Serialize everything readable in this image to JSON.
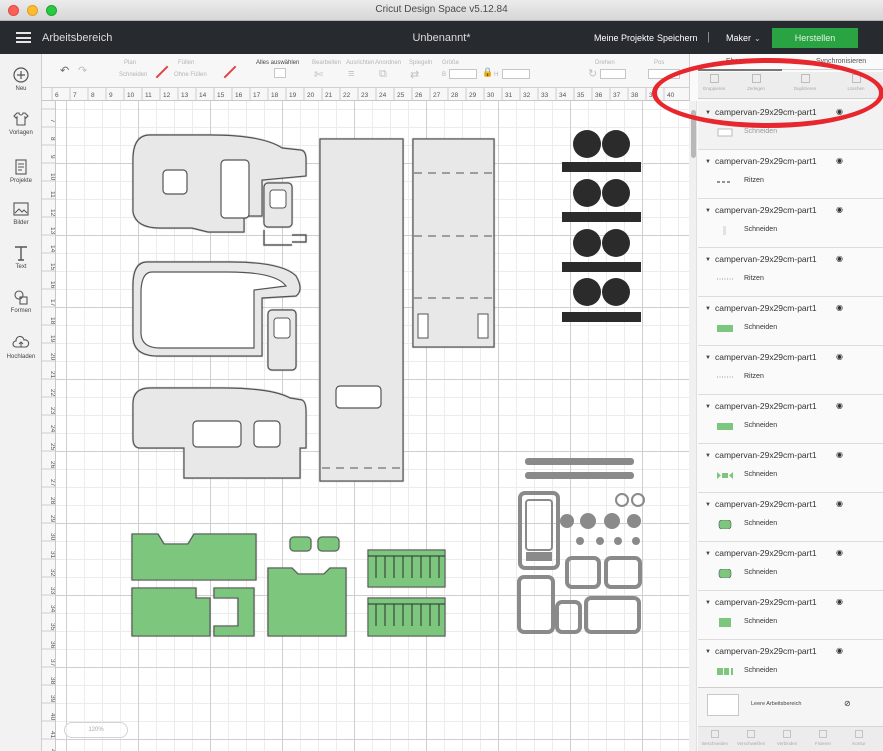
{
  "window": {
    "title": "Cricut Design Space  v5.12.84"
  },
  "header": {
    "workspace_label": "Arbeitsbereich",
    "project_name": "Unbenannt*",
    "my_projects": "Meine Projekte",
    "save": "Speichern",
    "separator": "|",
    "machine": "Maker",
    "make_it": "Herstellen"
  },
  "sidebar": {
    "items": [
      {
        "label": "Neu",
        "icon": "plus-circle-icon"
      },
      {
        "label": "Vorlagen",
        "icon": "shirt-icon"
      },
      {
        "label": "Projekte",
        "icon": "projects-icon"
      },
      {
        "label": "Bilder",
        "icon": "image-icon"
      },
      {
        "label": "Text",
        "icon": "text-icon"
      },
      {
        "label": "Formen",
        "icon": "shapes-icon"
      },
      {
        "label": "Hochladen",
        "icon": "upload-cloud-icon"
      }
    ]
  },
  "toolbar": {
    "line_type_label": "Plan",
    "line_type_value": "Schneiden",
    "fill_label": "Füllen",
    "fill_value": "Ohne Füllen",
    "select_all": "Alles auswählen",
    "edit": "Bearbeiten",
    "align": "Ausrichten",
    "arrange": "Anordnen",
    "flip": "Spiegeln",
    "size": "Größe",
    "width_short": "B",
    "height_short": "H",
    "rotate": "Drehen",
    "position": "Pos"
  },
  "ruler_top": [
    "6",
    "7",
    "8",
    "9",
    "10",
    "11",
    "12",
    "13",
    "14",
    "15",
    "16",
    "17",
    "18",
    "19",
    "20",
    "21",
    "22",
    "23",
    "24",
    "25",
    "26",
    "27",
    "28",
    "29",
    "30",
    "31",
    "32",
    "33",
    "34",
    "35",
    "36",
    "37",
    "38",
    "39",
    "40"
  ],
  "ruler_left": [
    "7",
    "8",
    "9",
    "10",
    "11",
    "12",
    "13",
    "14",
    "15",
    "16",
    "17",
    "18",
    "19",
    "20",
    "21",
    "22",
    "23",
    "24",
    "25",
    "26",
    "27",
    "28",
    "29",
    "30",
    "31",
    "32",
    "33",
    "34",
    "35",
    "36",
    "37",
    "38",
    "39",
    "40",
    "41",
    "42"
  ],
  "zoom": "120%",
  "colors": {
    "accent_green": "#2aa342",
    "part_fill_green": "#7cc67e",
    "part_grey": "#e8e8e8",
    "black_part": "#2b2b2b",
    "annotation_red": "#e8262d",
    "header_bg": "#272b30"
  },
  "layers_panel": {
    "tab_layers": "Ebenen",
    "tab_sync": "Synchronisieren",
    "tools": [
      "Gruppieren",
      "Zerlegen",
      "Duplizieren",
      "Löschen"
    ],
    "layers": [
      {
        "name": "campervan-29x29cm-part1",
        "op": "Schneiden",
        "swatch": "outline-grey",
        "selected": true
      },
      {
        "name": "campervan-29x29cm-part1",
        "op": "Ritzen",
        "swatch": "score-dashes"
      },
      {
        "name": "campervan-29x29cm-part1",
        "op": "Schneiden",
        "swatch": "thin-grey"
      },
      {
        "name": "campervan-29x29cm-part1",
        "op": "Ritzen",
        "swatch": "score-dots"
      },
      {
        "name": "campervan-29x29cm-part1",
        "op": "Schneiden",
        "swatch": "green-rect"
      },
      {
        "name": "campervan-29x29cm-part1",
        "op": "Ritzen",
        "swatch": "score-dots"
      },
      {
        "name": "campervan-29x29cm-part1",
        "op": "Schneiden",
        "swatch": "green-rect"
      },
      {
        "name": "campervan-29x29cm-part1",
        "op": "Schneiden",
        "swatch": "green-bow"
      },
      {
        "name": "campervan-29x29cm-part1",
        "op": "Schneiden",
        "swatch": "green-rounded"
      },
      {
        "name": "campervan-29x29cm-part1",
        "op": "Schneiden",
        "swatch": "green-rounded"
      },
      {
        "name": "campervan-29x29cm-part1",
        "op": "Schneiden",
        "swatch": "green-block"
      },
      {
        "name": "campervan-29x29cm-part1",
        "op": "Schneiden",
        "swatch": "green-pair"
      }
    ],
    "blank_canvas": "Leere Arbeitsbereich",
    "footer": [
      "Beschneiden",
      "Verschweißen",
      "Verbinden",
      "Fixieren",
      "Kontur"
    ]
  }
}
